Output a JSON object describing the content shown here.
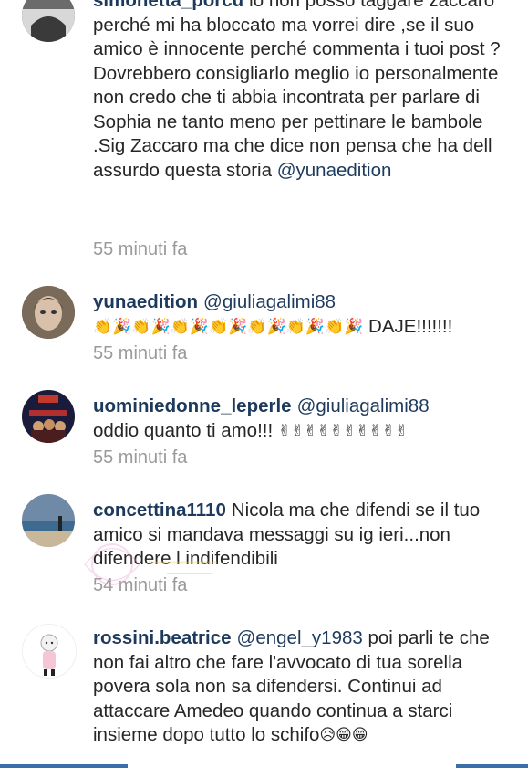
{
  "comments": [
    {
      "username": "simonetta_porcu",
      "text": "lo non posso taggare zaccaro perché mi ha bloccato ma vorrei dire ,se il suo amico è innocente perché commenta i tuoi post ?Dovrebbero consigliarlo meglio io personalmente non credo che ti abbia incontrata per parlare di Sophia ne tanto meno per pettinare le bambole .Sig Zaccaro ma che dice non pensa che ha dell assurdo questa storia",
      "mention_after": "@yunaedition",
      "time": "55 minuti fa"
    },
    {
      "username": "yunaedition",
      "mention": "@giuliagalimi88",
      "emoji_row": "👏🎉👏🎉👏🎉👏🎉👏🎉👏🎉👏🎉",
      "text": "DAJE!!!!!!!",
      "time": "55 minuti fa"
    },
    {
      "username": "uominiedonne_leperle",
      "mention": "@giuliagalimi88",
      "text": "oddio quanto ti amo!!!",
      "emoji_row": "✌✌✌✌✌✌✌✌✌✌",
      "time": "55 minuti fa"
    },
    {
      "username": "concettina1110",
      "text": "Nicola ma che difendi se il tuo amico si mandava messaggi su ig ieri...non difendere l indifendibili",
      "time": "54 minuti fa"
    },
    {
      "username": "rossini.beatrice",
      "mention": "@engel_y1983",
      "text": "poi parli te che non fai altro che fare l'avvocato di tua sorella povera sola non sa difendersi. Continui ad attaccare Amedeo quando continua a starci insieme dopo tutto lo schifo",
      "emoji_tail": "😥😁😁"
    }
  ],
  "colors": {
    "username": "#1d3a5c",
    "time": "#9a9a9a",
    "text": "#262626"
  }
}
